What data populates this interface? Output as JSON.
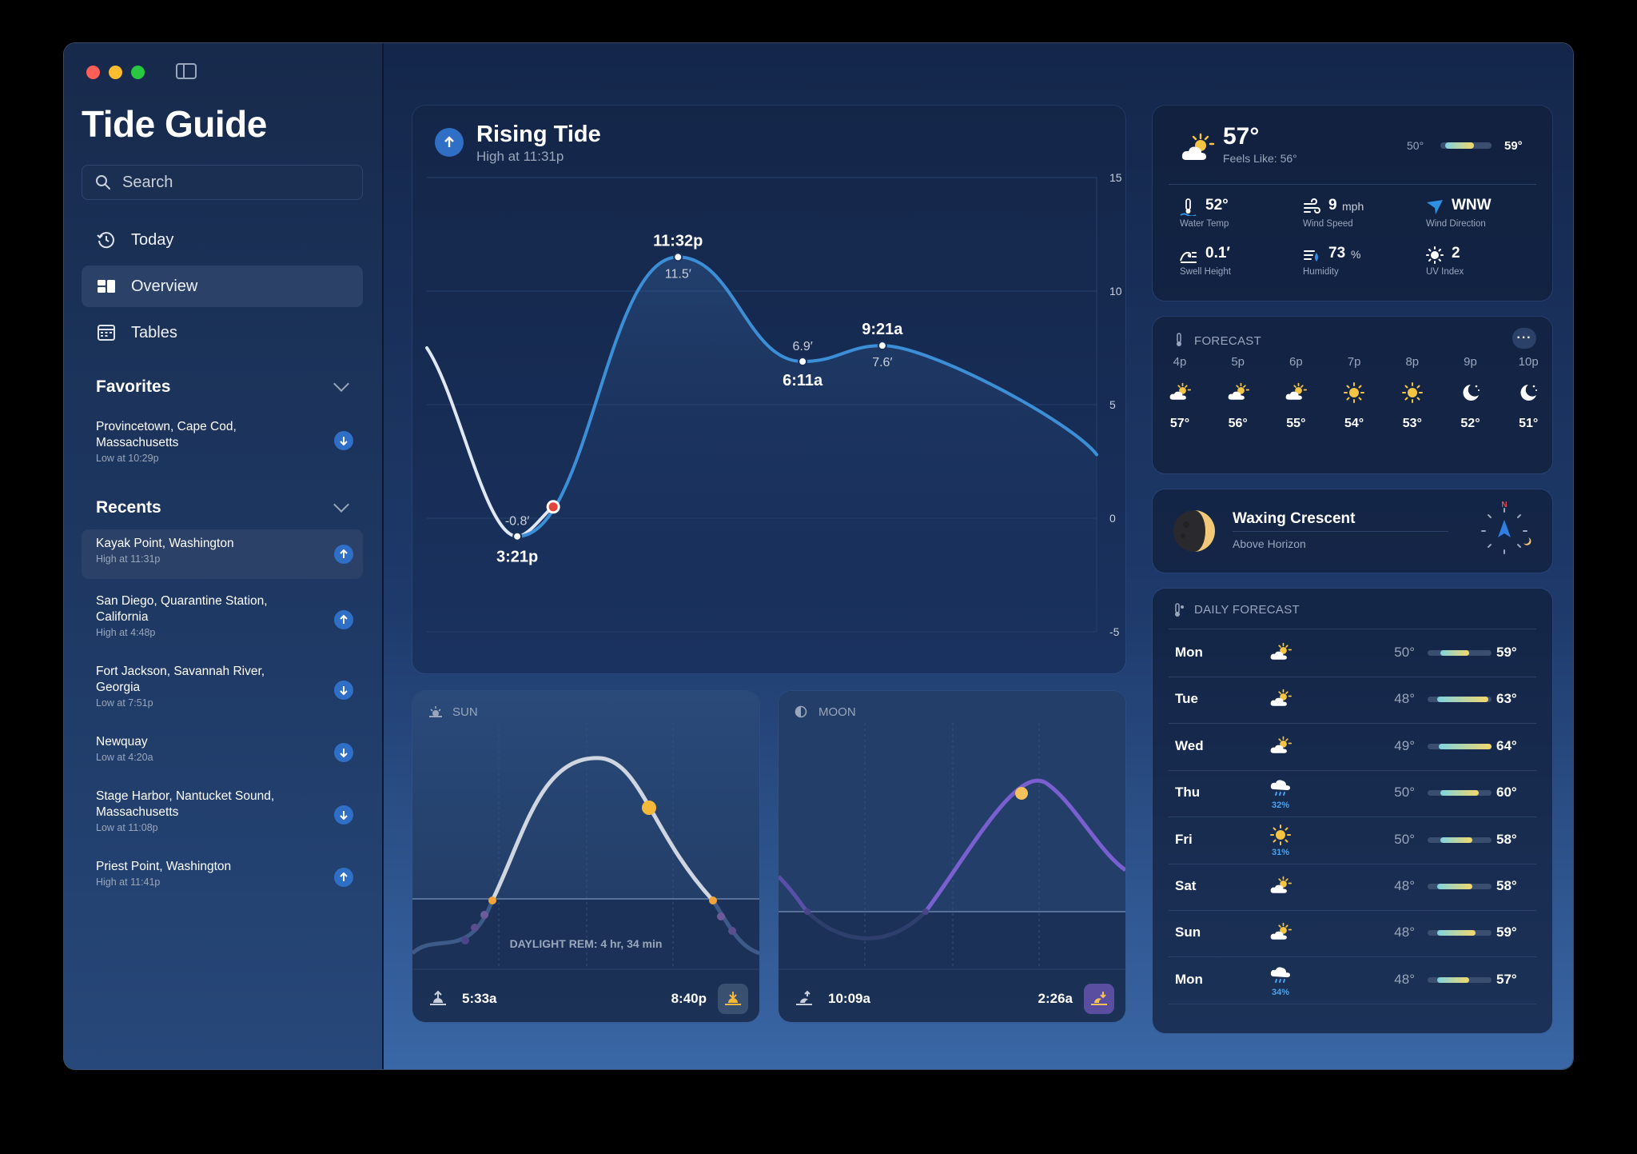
{
  "app_title": "Tide Guide",
  "search": {
    "placeholder": "Search"
  },
  "nav": [
    {
      "label": "Today",
      "icon": "history-clock-icon"
    },
    {
      "label": "Overview",
      "icon": "dashboard-icon"
    },
    {
      "label": "Tables",
      "icon": "calendar-table-icon"
    }
  ],
  "favorites": {
    "title": "Favorites",
    "items": [
      {
        "name": "Provincetown, Cape Cod, Massachusetts",
        "sub": "Low at 10:29p",
        "direction": "down"
      }
    ]
  },
  "recents": {
    "title": "Recents",
    "items": [
      {
        "name": "Kayak Point, Washington",
        "sub": "High at 11:31p",
        "direction": "up"
      },
      {
        "name": "San Diego, Quarantine Station, California",
        "sub": "High at 4:48p",
        "direction": "up"
      },
      {
        "name": "Fort Jackson, Savannah River, Georgia",
        "sub": "Low at 7:51p",
        "direction": "down"
      },
      {
        "name": "Newquay",
        "sub": "Low at 4:20a",
        "direction": "down"
      },
      {
        "name": "Stage Harbor, Nantucket Sound, Massachusetts",
        "sub": "Low at 11:08p",
        "direction": "down"
      },
      {
        "name": "Priest Point, Washington",
        "sub": "High at 11:41p",
        "direction": "up"
      }
    ]
  },
  "tide": {
    "title": "Rising Tide",
    "subtitle": "High at 11:31p",
    "points": [
      {
        "time": "3:21p",
        "height": "-0.8′"
      },
      {
        "time": "11:32p",
        "height": "11.5′"
      },
      {
        "time": "6:11a",
        "height": "6.9′"
      },
      {
        "time": "9:21a",
        "height": "7.6′"
      }
    ]
  },
  "chart_data": {
    "type": "line",
    "title": "Rising Tide",
    "subtitle": "High at 11:31p",
    "y_ticks": [
      15,
      10,
      5,
      0,
      -5
    ],
    "ylim": [
      -5,
      15
    ],
    "series": [
      {
        "x": [
          "3:21p",
          "11:32p",
          "6:11a",
          "9:21a"
        ],
        "values": [
          -0.8,
          11.5,
          6.9,
          7.6
        ]
      }
    ],
    "grid": true
  },
  "weather": {
    "temp": "57°",
    "feels": "Feels Like: 56°",
    "low": "50°",
    "high": "59°",
    "stats": [
      {
        "value": "52°",
        "unit": "",
        "label": "Water Temp",
        "icon": "water-thermometer-icon"
      },
      {
        "value": "9",
        "unit": "mph",
        "label": "Wind Speed",
        "icon": "wind-icon"
      },
      {
        "value": "WNW",
        "unit": "",
        "label": "Wind Direction",
        "icon": "direction-arrow-icon"
      },
      {
        "value": "0.1′",
        "unit": "",
        "label": "Swell Height",
        "icon": "wave-icon"
      },
      {
        "value": "73",
        "unit": "%",
        "label": "Humidity",
        "icon": "humidity-icon"
      },
      {
        "value": "2",
        "unit": "",
        "label": "UV Index",
        "icon": "sun-icon"
      }
    ]
  },
  "hourly": {
    "title": "FORECAST",
    "hours": [
      {
        "time": "4p",
        "temp": "57°",
        "icon": "partly-cloudy-icon"
      },
      {
        "time": "5p",
        "temp": "56°",
        "icon": "partly-cloudy-icon"
      },
      {
        "time": "6p",
        "temp": "55°",
        "icon": "partly-cloudy-icon"
      },
      {
        "time": "7p",
        "temp": "54°",
        "icon": "sun-icon"
      },
      {
        "time": "8p",
        "temp": "53°",
        "icon": "sun-icon"
      },
      {
        "time": "9p",
        "temp": "52°",
        "icon": "moon-stars-icon"
      },
      {
        "time": "10p",
        "temp": "51°",
        "icon": "moon-stars-icon"
      }
    ]
  },
  "moon_phase": {
    "title": "Waxing Crescent",
    "sub": "Above Horizon",
    "compass_n": "N"
  },
  "daily": {
    "title": "DAILY FORECAST",
    "days": [
      {
        "day": "Mon",
        "low": "50°",
        "high": "59°",
        "icon": "partly-cloudy-icon",
        "precip": "",
        "bar": [
          0.2,
          0.65
        ]
      },
      {
        "day": "Tue",
        "low": "48°",
        "high": "63°",
        "icon": "partly-cloudy-icon",
        "precip": "",
        "bar": [
          0.15,
          0.95
        ]
      },
      {
        "day": "Wed",
        "low": "49°",
        "high": "64°",
        "icon": "partly-cloudy-icon",
        "precip": "",
        "bar": [
          0.18,
          1.0
        ]
      },
      {
        "day": "Thu",
        "low": "50°",
        "high": "60°",
        "icon": "rain-cloud-icon",
        "precip": "32%",
        "bar": [
          0.2,
          0.8
        ]
      },
      {
        "day": "Fri",
        "low": "50°",
        "high": "58°",
        "icon": "sun-icon",
        "precip": "31%",
        "bar": [
          0.2,
          0.7
        ]
      },
      {
        "day": "Sat",
        "low": "48°",
        "high": "58°",
        "icon": "partly-cloudy-icon",
        "precip": "",
        "bar": [
          0.15,
          0.7
        ]
      },
      {
        "day": "Sun",
        "low": "48°",
        "high": "59°",
        "icon": "partly-cloudy-icon",
        "precip": "",
        "bar": [
          0.15,
          0.75
        ]
      },
      {
        "day": "Mon",
        "low": "48°",
        "high": "57°",
        "icon": "rain-cloud-icon",
        "precip": "34%",
        "bar": [
          0.15,
          0.65
        ]
      }
    ]
  },
  "sun": {
    "title": "SUN",
    "daylight": "DAYLIGHT REM: 4 hr, 34 min",
    "rise": "5:33a",
    "set": "8:40p"
  },
  "moon": {
    "title": "MOON",
    "rise": "10:09a",
    "set": "2:26a"
  }
}
